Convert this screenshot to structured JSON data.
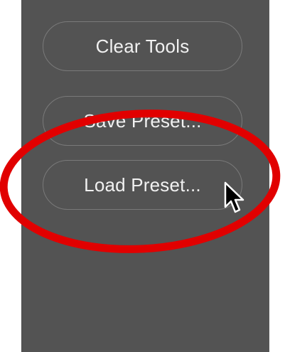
{
  "panel": {
    "buttons": [
      {
        "label": "Clear Tools"
      },
      {
        "label": "Save Preset..."
      },
      {
        "label": "Load Preset..."
      }
    ]
  },
  "annotation": {
    "highlight_color": "#e10000",
    "highlight_target": "Load Preset..."
  },
  "cursor": {
    "icon": "arrow-pointer-icon"
  }
}
